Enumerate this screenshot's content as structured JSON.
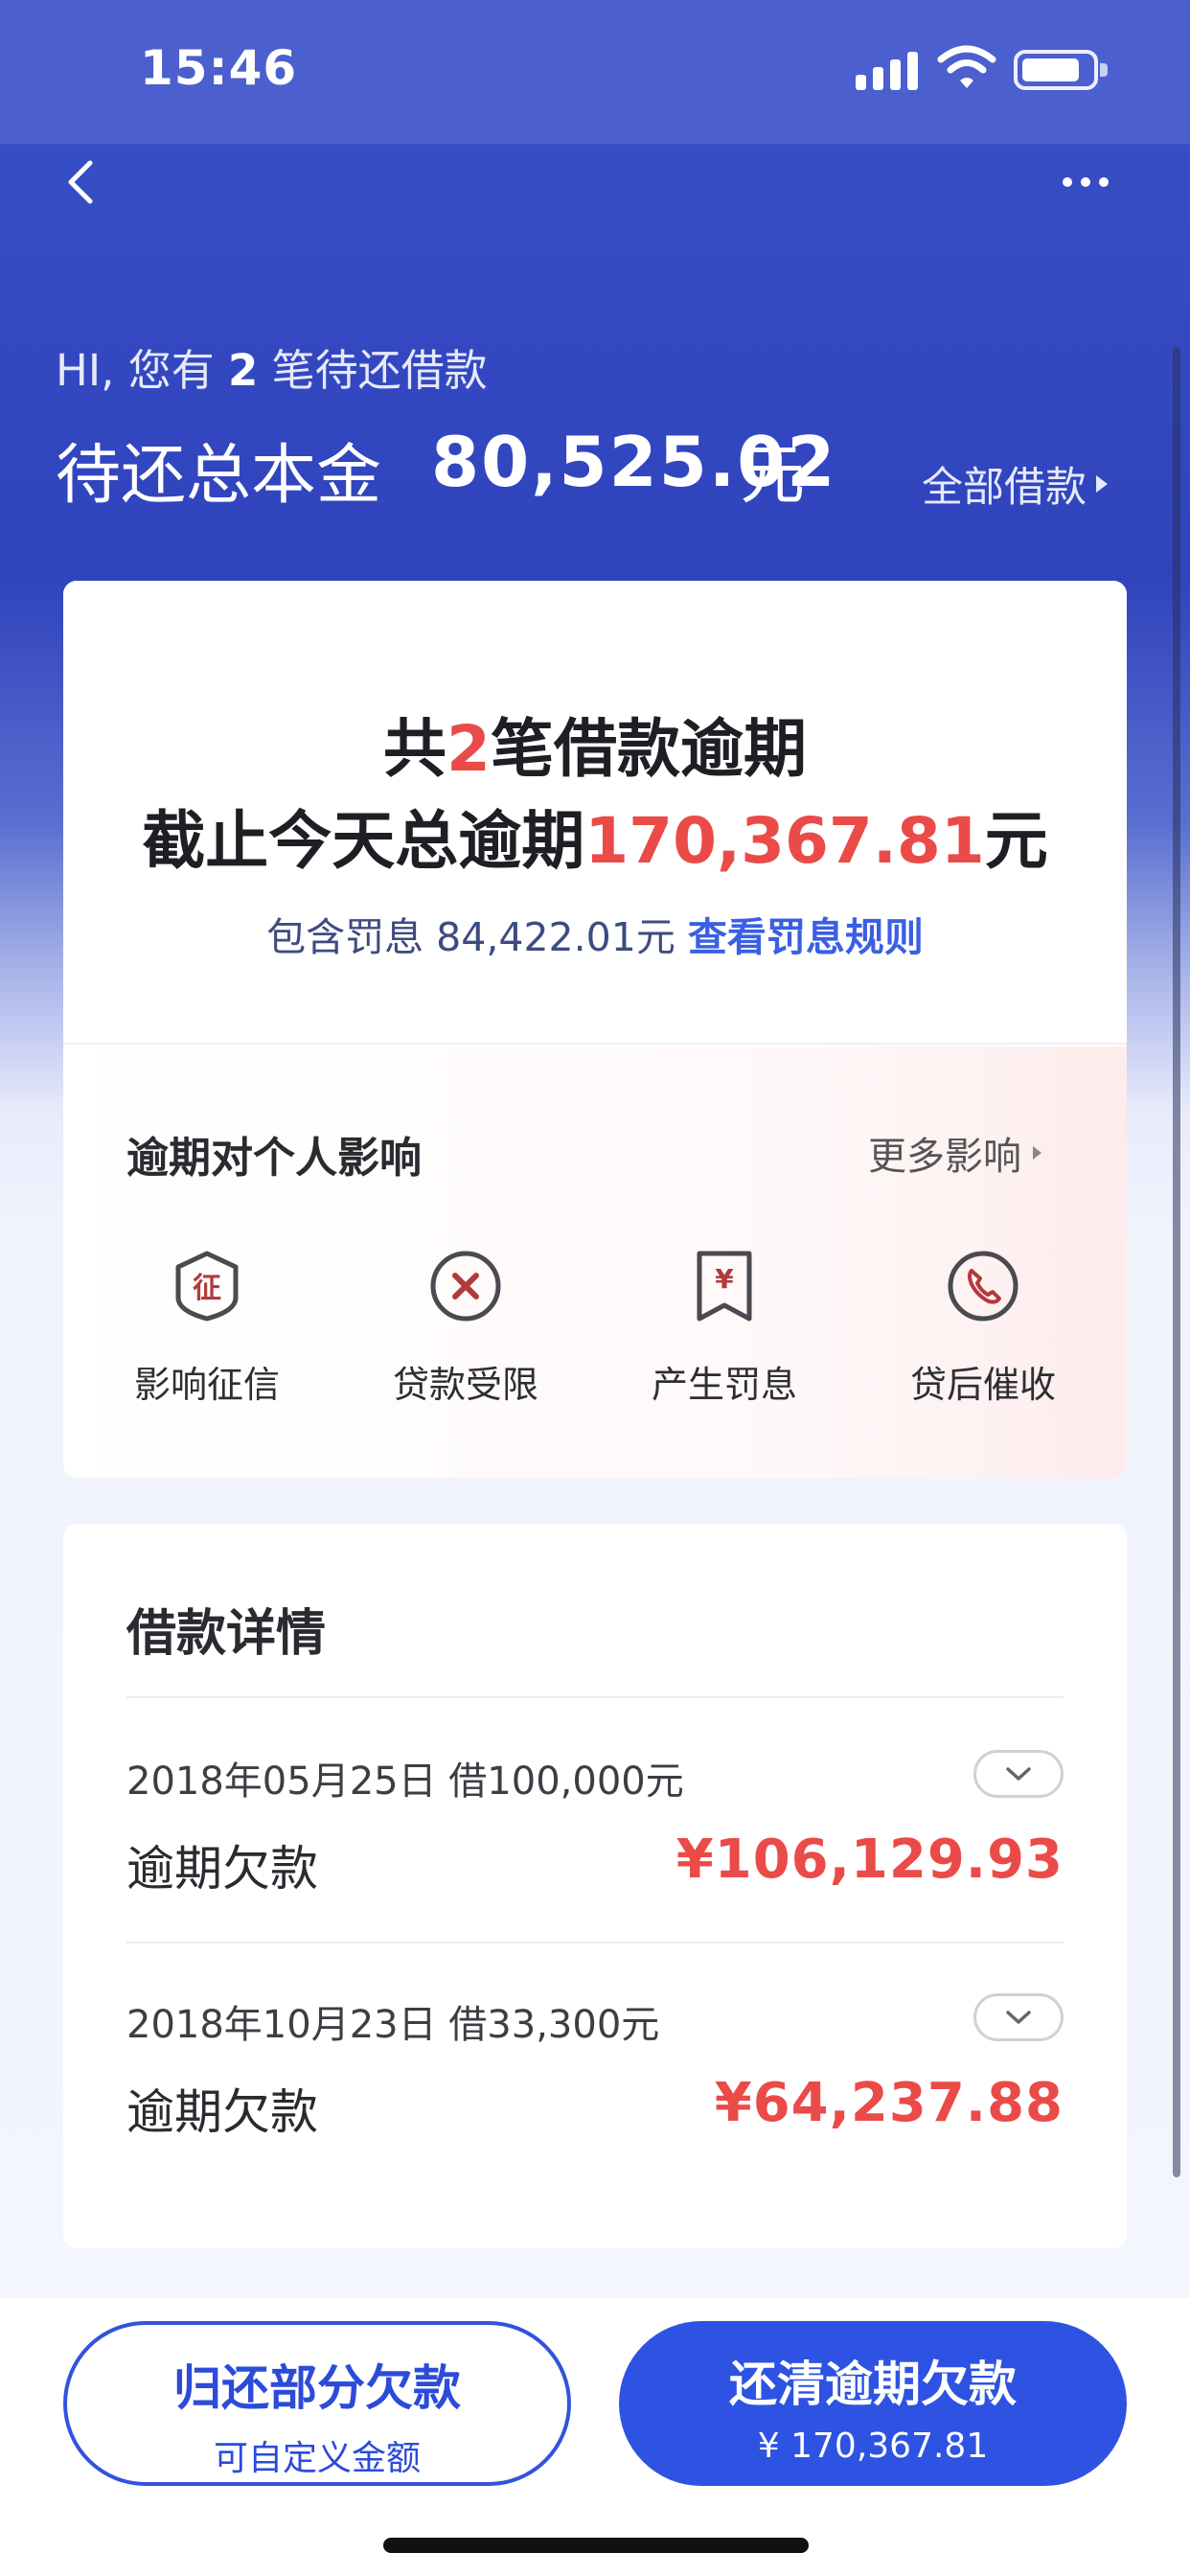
{
  "status_bar": {
    "time": "15:46"
  },
  "header": {
    "greeting_prefix": "HI, 您有",
    "greeting_count": "2",
    "greeting_suffix": "笔待还借款",
    "principal_label": "待还总本金",
    "principal_value": "80,525.02",
    "principal_unit": "元",
    "all_loans_label": "全部借款"
  },
  "overdue_summary": {
    "line1_prefix": "共",
    "line1_count": "2",
    "line1_suffix": "笔借款逾期",
    "line2_prefix": "截止今天总逾期",
    "line2_amount": "170,367.81",
    "line2_suffix": "元",
    "penalty_text": "包含罚息 84,422.01元",
    "penalty_link": "查看罚息规则"
  },
  "impact": {
    "title": "逾期对个人影响",
    "more_label": "更多影响",
    "items": [
      {
        "label": "影响征信",
        "icon": "credit-shield-icon",
        "glyph": "征"
      },
      {
        "label": "贷款受限",
        "icon": "x-circle-icon"
      },
      {
        "label": "产生罚息",
        "icon": "receipt-yen-icon",
        "glyph": "¥"
      },
      {
        "label": "贷后催收",
        "icon": "phone-icon"
      }
    ]
  },
  "loan_details": {
    "title": "借款详情",
    "loans": [
      {
        "meta": "2018年05月25日  借100,000元",
        "label": "逾期欠款",
        "amount": "¥106,129.93"
      },
      {
        "meta": "2018年10月23日  借33,300元",
        "label": "逾期欠款",
        "amount": "¥64,237.88"
      }
    ]
  },
  "footer": {
    "partial_main": "归还部分欠款",
    "partial_sub": "可自定义金额",
    "clear_main": "还清逾期欠款",
    "clear_sub": "¥ 170,367.81"
  },
  "colors": {
    "header_blue": "#2f43bd",
    "accent_red": "#ea4b48",
    "primary_button": "#2e53e2",
    "link_blue": "#3a5fe3",
    "icon_red": "#b23a3a"
  }
}
